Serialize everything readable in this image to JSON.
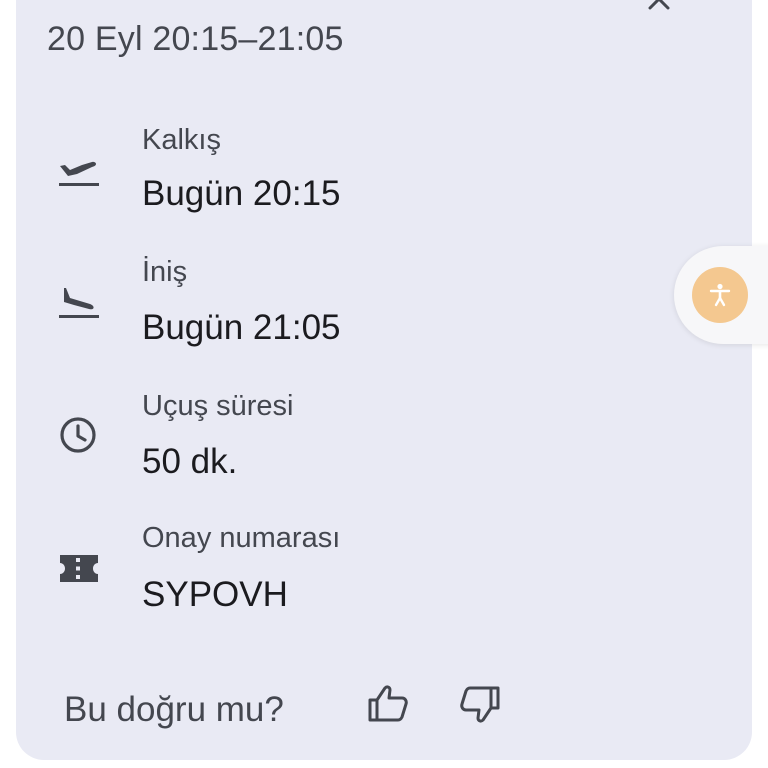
{
  "header": {
    "date_range": "20 Eyl 20:15–21:05"
  },
  "details": [
    {
      "icon": "flight-takeoff-icon",
      "label": "Kalkış",
      "value": "Bugün 20:15"
    },
    {
      "icon": "flight-land-icon",
      "label": "İniş",
      "value": "Bugün 21:05"
    },
    {
      "icon": "clock-icon",
      "label": "Uçuş süresi",
      "value": "50 dk."
    },
    {
      "icon": "ticket-icon",
      "label": "Onay numarası",
      "value": "SYPOVH"
    }
  ],
  "feedback": {
    "question": "Bu doğru mu?",
    "thumbs_up_icon": "thumbs-up-icon",
    "thumbs_down_icon": "thumbs-down-icon"
  },
  "accessibility": {
    "icon": "accessibility-icon",
    "color": "#f4c890"
  },
  "colors": {
    "card_background": "#e9eaf4",
    "primary_text": "#1b1b1f",
    "secondary_text": "#44474f"
  }
}
